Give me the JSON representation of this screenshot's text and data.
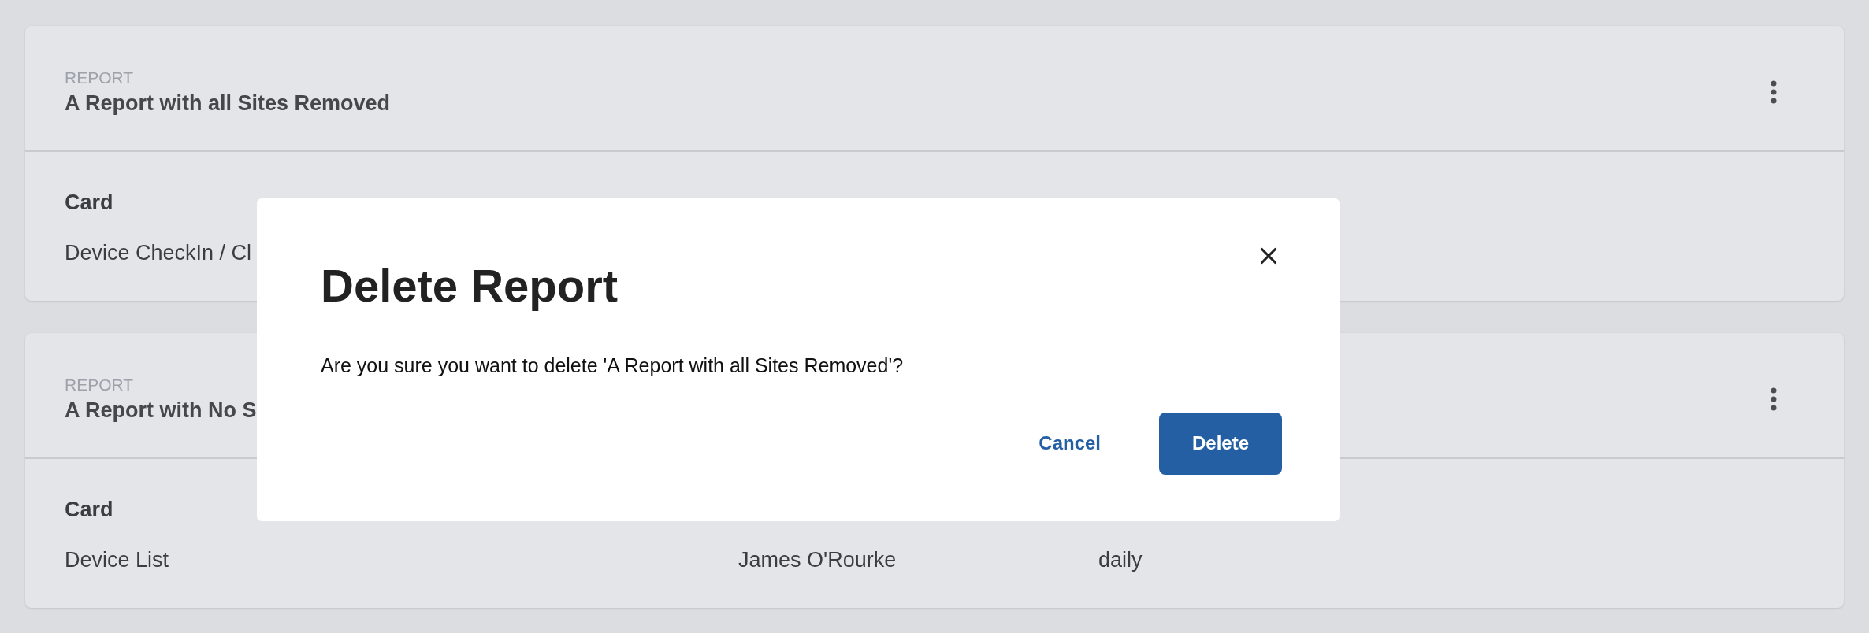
{
  "reports": [
    {
      "label": "REPORT",
      "title": "A Report with all Sites Removed",
      "columns": [
        "Card"
      ],
      "values": [
        "Device CheckIn / Cl"
      ]
    },
    {
      "label": "REPORT",
      "title": "A Report with No S",
      "columns": [
        "Card"
      ],
      "values": [
        "Device List",
        "James O'Rourke",
        "daily"
      ]
    }
  ],
  "dialog": {
    "title": "Delete Report",
    "message": "Are you sure you want to delete 'A Report with all Sites Removed'?",
    "cancel": "Cancel",
    "confirm": "Delete"
  }
}
